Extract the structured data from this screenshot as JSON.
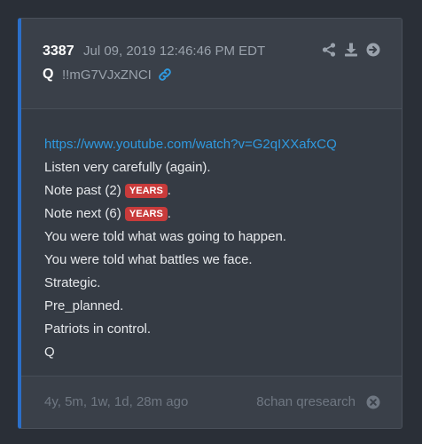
{
  "post": {
    "id": "3387",
    "timestamp": "Jul 09, 2019 12:46:46 PM EDT",
    "author": "Q",
    "tripcode": "!!mG7VJxZNCI"
  },
  "body": {
    "url": "https://www.youtube.com/watch?v=G2qIXXafxCQ",
    "line1": "Listen very carefully (again).",
    "line2_prefix": "Note past (2)",
    "line2_badge": "YEARS",
    "line2_suffix": ".",
    "line3_prefix": "Note next (6)",
    "line3_badge": "YEARS",
    "line3_suffix": ".",
    "line4": "You were told what was going to happen.",
    "line5": "You were told what battles we face.",
    "line6": "Strategic.",
    "line7": "Pre_planned.",
    "line8": "Patriots in control.",
    "line9": "Q"
  },
  "footer": {
    "age": "4y, 5m, 1w, 1d, 28m ago",
    "source": "8chan qresearch"
  },
  "icons": {
    "share": "share-icon",
    "download": "download-icon",
    "forward": "arrow-right-circle-icon",
    "link": "link-icon",
    "close": "close-circle-icon"
  },
  "colors": {
    "accent": "#2b6fc9",
    "link": "#2f9ae0",
    "badge": "#c93b3b",
    "card": "#353b44",
    "background": "#2a2f37"
  }
}
